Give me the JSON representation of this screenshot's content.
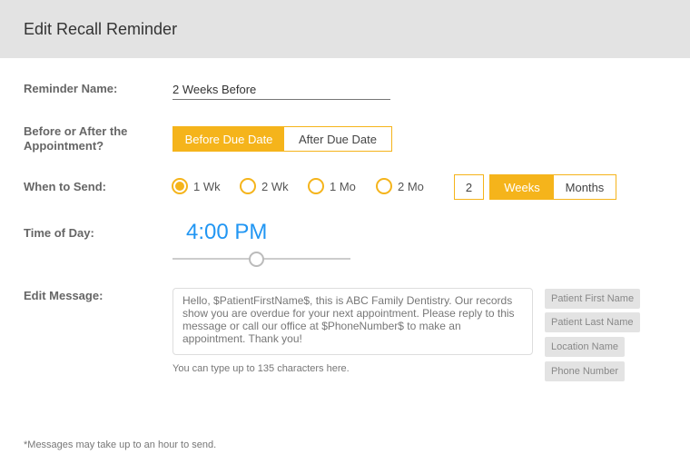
{
  "title": "Edit Recall Reminder",
  "labels": {
    "name": "Reminder Name:",
    "before_after": "Before or After the Appointment?",
    "when": "When to Send:",
    "time": "Time of Day:",
    "message": "Edit Message:"
  },
  "reminder_name": "2 Weeks Before",
  "before_after": {
    "options": [
      "Before Due Date",
      "After Due Date"
    ],
    "selected": "Before Due Date"
  },
  "when": {
    "options": [
      "1 Wk",
      "2 Wk",
      "1 Mo",
      "2 Mo"
    ],
    "selected": "1 Wk",
    "custom_number": "2",
    "units": [
      "Weeks",
      "Months"
    ],
    "selected_unit": "Weeks"
  },
  "time_of_day": {
    "value": "4:00 PM",
    "slider_fraction": 0.47
  },
  "message": {
    "text": "Hello, $PatientFirstName$, this is ABC Family Dentistry. Our records show you are overdue for your next appointment. Please reply to this message or call our office at $PhoneNumber$ to make an appointment. Thank you!",
    "hint": "You can type up to 135 characters here."
  },
  "tags": [
    "Patient First Name",
    "Patient Last Name",
    "Location Name",
    "Phone Number"
  ],
  "footnote": "*Messages may take up to an hour to send.",
  "colors": {
    "accent": "#f5b41b",
    "time": "#2196f3"
  }
}
